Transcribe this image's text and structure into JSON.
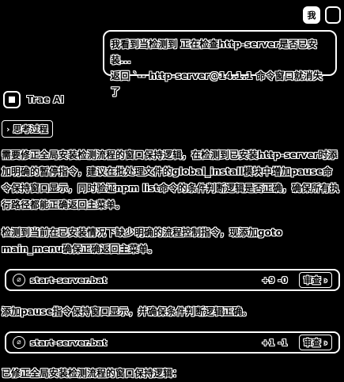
{
  "user": {
    "avatar_label": "我",
    "message_line1": "我看到当检测到 正在检查http-server是否已安装...",
    "message_line2": "返回   `-- http-server@14.1.1  命令窗口就消失了"
  },
  "assistant": {
    "name": "Trae AI",
    "thinking_label": "思考过程",
    "paragraph1": "需要修正全局安装检测流程的窗口保持逻辑，在检测到已安装http-server时添加明确的暂停指令，建议在批处理文件的global_install模块中增加pause命令保持窗口显示，同时验证npm list命令的条件判断逻辑是否正确，确保所有执行路径都能正确返回主菜单。",
    "paragraph2": "检测到当前在已安装情况下缺少明确的流程控制指令，现添加goto main_menu确保正确返回主菜单。",
    "paragraph3": "添加pause指令保持窗口显示，并确保条件判断逻辑正确。",
    "paragraph4": "已修正全局安装检测流程的窗口保持逻辑："
  },
  "file_changes": [
    {
      "file_name": "start-server.bat",
      "diff": "+9 -0",
      "view_label": "审查 ›"
    },
    {
      "file_name": "start-server.bat",
      "diff": "+1 -1",
      "view_label": "审查 ›"
    }
  ]
}
